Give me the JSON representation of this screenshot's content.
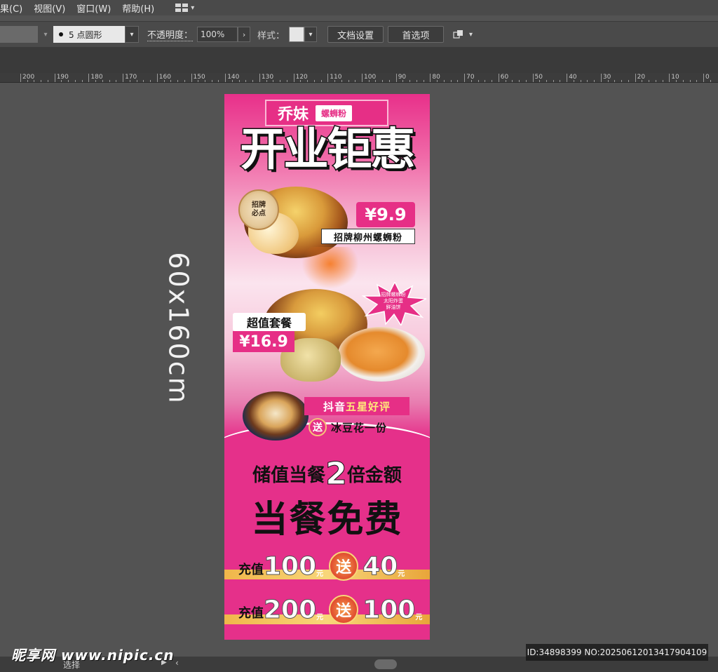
{
  "menu": {
    "items": [
      "果(C)",
      "视图(V)",
      "窗口(W)",
      "帮助(H)"
    ]
  },
  "control_bar": {
    "brush_label": "5 点圆形",
    "opacity_label": "不透明度：",
    "opacity_value": "100%",
    "style_label": "样式：",
    "doc_settings_label": "文档设置",
    "preferences_label": "首选项"
  },
  "ruler": {
    "labels": [
      "200",
      "190",
      "180",
      "170",
      "160",
      "150",
      "140",
      "130",
      "120",
      "110",
      "100",
      "90",
      "80",
      "70",
      "60",
      "50",
      "40",
      "30",
      "20",
      "10",
      "0"
    ]
  },
  "canvas": {
    "dimension_label": "60x160cm"
  },
  "poster": {
    "brand_name": "乔妹",
    "brand_tag": "螺蛳粉",
    "headline": "开业钜惠",
    "badge_line1": "招牌",
    "badge_line2": "必点",
    "price1": "¥9.9",
    "dish1": "招牌柳州螺蛳粉",
    "star_line1": "招牌螺蛳粉",
    "star_line2": "太阳炸蛋",
    "star_line3": "鲜油饼",
    "combo_label": "超值套餐",
    "price2": "¥16.9",
    "douyin_prefix": "抖音",
    "douyin_highlight": "五星好评",
    "gift_badge": "送",
    "gift_text": "冰豆花一份",
    "promo_prefix": "储值当餐",
    "promo_number": "2",
    "promo_suffix": "倍金额",
    "promo_main": "当餐免费",
    "recharge_label": "充值",
    "recharge1_amount": "100",
    "recharge1_bonus": "40",
    "recharge2_amount": "200",
    "recharge2_bonus": "100",
    "unit": "元",
    "send": "送"
  },
  "status_bar": {
    "tool_label": "选择"
  },
  "watermark": {
    "logo": "昵享网 www.nipic.cn",
    "id_text": "ID:34898399 NO:20250612013417904109"
  },
  "colors": {
    "poster_pink": "#e5308a",
    "ui_dark": "#4a4a4a",
    "canvas_gray": "#535353"
  }
}
